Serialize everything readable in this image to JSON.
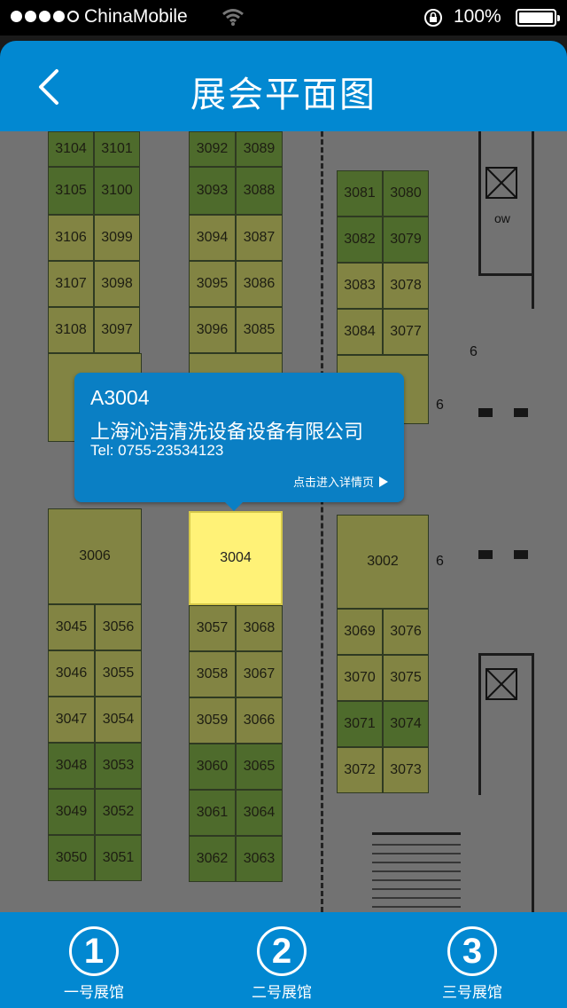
{
  "status_bar": {
    "carrier": "ChinaMobile",
    "battery": "100%"
  },
  "header": {
    "title": "展会平面图"
  },
  "booths": [
    {
      "id": "3104",
      "c": "g"
    },
    {
      "id": "3101",
      "c": "g"
    },
    {
      "id": "3105",
      "c": "g"
    },
    {
      "id": "3100",
      "c": "g"
    },
    {
      "id": "3106",
      "c": "o"
    },
    {
      "id": "3099",
      "c": "o"
    },
    {
      "id": "3107",
      "c": "o"
    },
    {
      "id": "3098",
      "c": "o"
    },
    {
      "id": "3108",
      "c": "o"
    },
    {
      "id": "3097",
      "c": "o"
    },
    {
      "id": "3092",
      "c": "g"
    },
    {
      "id": "3089",
      "c": "g"
    },
    {
      "id": "3093",
      "c": "g"
    },
    {
      "id": "3088",
      "c": "g"
    },
    {
      "id": "3094",
      "c": "o"
    },
    {
      "id": "3087",
      "c": "o"
    },
    {
      "id": "3095",
      "c": "o"
    },
    {
      "id": "3086",
      "c": "o"
    },
    {
      "id": "3096",
      "c": "o"
    },
    {
      "id": "3085",
      "c": "o"
    },
    {
      "id": "3081",
      "c": "g"
    },
    {
      "id": "3080",
      "c": "g"
    },
    {
      "id": "3082",
      "c": "g"
    },
    {
      "id": "3079",
      "c": "g"
    },
    {
      "id": "3083",
      "c": "o"
    },
    {
      "id": "3078",
      "c": "o"
    },
    {
      "id": "3084",
      "c": "o"
    },
    {
      "id": "3077",
      "c": "o"
    },
    {
      "id": "3006",
      "c": "o"
    },
    {
      "id": "3045",
      "c": "o"
    },
    {
      "id": "3056",
      "c": "o"
    },
    {
      "id": "3046",
      "c": "o"
    },
    {
      "id": "3055",
      "c": "o"
    },
    {
      "id": "3047",
      "c": "o"
    },
    {
      "id": "3054",
      "c": "o"
    },
    {
      "id": "3048",
      "c": "g"
    },
    {
      "id": "3053",
      "c": "g"
    },
    {
      "id": "3049",
      "c": "g"
    },
    {
      "id": "3052",
      "c": "g"
    },
    {
      "id": "3050",
      "c": "g"
    },
    {
      "id": "3051",
      "c": "g"
    },
    {
      "id": "3004",
      "c": "sel"
    },
    {
      "id": "3057",
      "c": "o"
    },
    {
      "id": "3068",
      "c": "o"
    },
    {
      "id": "3058",
      "c": "o"
    },
    {
      "id": "3067",
      "c": "o"
    },
    {
      "id": "3059",
      "c": "o"
    },
    {
      "id": "3066",
      "c": "o"
    },
    {
      "id": "3060",
      "c": "g"
    },
    {
      "id": "3065",
      "c": "g"
    },
    {
      "id": "3061",
      "c": "g"
    },
    {
      "id": "3064",
      "c": "g"
    },
    {
      "id": "3062",
      "c": "g"
    },
    {
      "id": "3063",
      "c": "g"
    },
    {
      "id": "3002",
      "c": "o"
    },
    {
      "id": "3069",
      "c": "o"
    },
    {
      "id": "3076",
      "c": "o"
    },
    {
      "id": "3070",
      "c": "o"
    },
    {
      "id": "3075",
      "c": "o"
    },
    {
      "id": "3071",
      "c": "g"
    },
    {
      "id": "3074",
      "c": "g"
    },
    {
      "id": "3072",
      "c": "o"
    },
    {
      "id": "3073",
      "c": "o"
    }
  ],
  "map_labels": {
    "six_a": "6",
    "six_b": "6",
    "six_c": "6",
    "ow": "ow"
  },
  "popup": {
    "code": "A3004",
    "company": "上海沁洁清洗设备设备有限公司",
    "tel": "Tel: 0755-23534123",
    "detail_link": "点击进入详情页"
  },
  "tabs": [
    {
      "number": "1",
      "label": "一号展馆"
    },
    {
      "number": "2",
      "label": "二号展馆"
    },
    {
      "number": "3",
      "label": "三号展馆"
    }
  ],
  "colors": {
    "brand": "#0288d1",
    "booth_green": "#4e6b2c",
    "booth_olive": "#828443",
    "booth_selected": "#fff277"
  }
}
